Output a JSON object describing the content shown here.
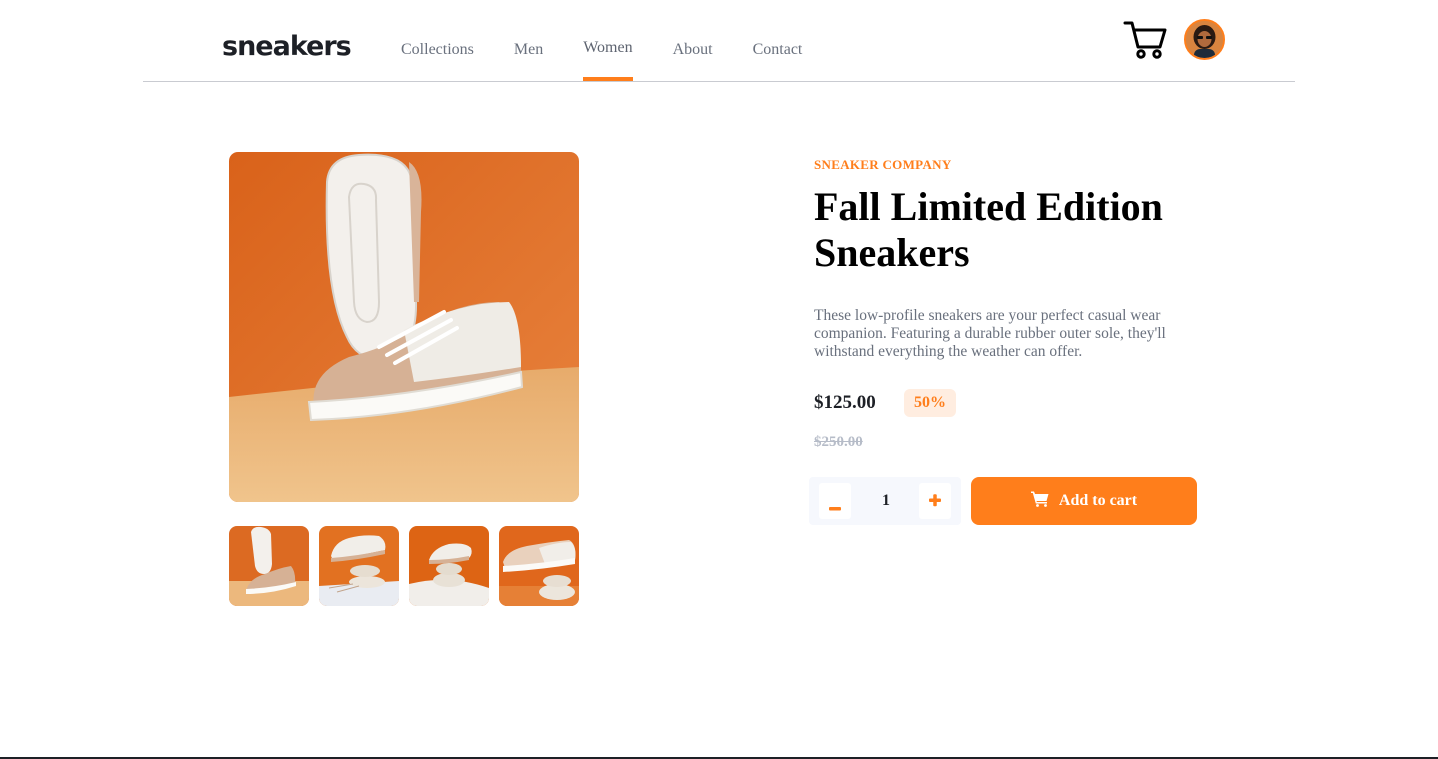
{
  "header": {
    "logo": "sneakers",
    "nav": [
      "Collections",
      "Men",
      "Women",
      "About",
      "Contact"
    ],
    "active_nav": "Women",
    "cart_icon": "cart-icon",
    "avatar_icon": "user-avatar"
  },
  "gallery": {
    "main_image": "sneaker-product-photo",
    "thumbnails": [
      "thumbnail-1",
      "thumbnail-2",
      "thumbnail-3",
      "thumbnail-4"
    ]
  },
  "product": {
    "company": "SNEAKER COMPANY",
    "title": "Fall Limited Edition Sneakers",
    "description": "These low-profile sneakers are your perfect casual wear companion. Featuring a durable rubber outer sole, they'll withstand everything the weather can offer.",
    "price": "$125.00",
    "discount": "50%",
    "original_price": "$250.00",
    "quantity": "1",
    "add_to_cart": "Add to cart"
  },
  "colors": {
    "accent": "#ff7e1b",
    "accent_light": "#ffede0",
    "text_dark": "#1d2026",
    "text_muted": "#69707d",
    "qty_bg": "#f6f8fd"
  }
}
